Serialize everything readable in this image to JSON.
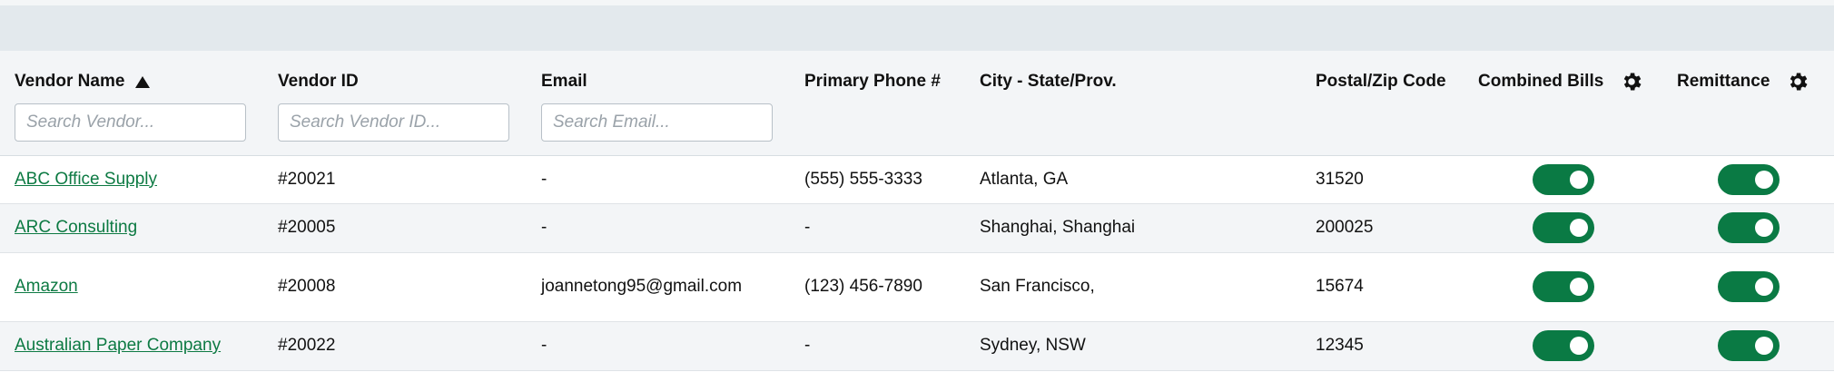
{
  "colors": {
    "accent": "#0a7a44",
    "link": "#0d7a43",
    "header_bg": "#f3f5f7",
    "topbar_bg": "#e3e9ed"
  },
  "table": {
    "headers": {
      "vendor_name": "Vendor Name",
      "vendor_id": "Vendor ID",
      "email": "Email",
      "phone": "Primary Phone #",
      "city": "City - State/Prov.",
      "postal": "Postal/Zip Code",
      "combined_bills": "Combined Bills",
      "remittance": "Remittance"
    },
    "sort": {
      "column": "vendor_name",
      "direction": "ascending",
      "icon": "sort-ascending-icon"
    },
    "search": {
      "vendor_placeholder": "Search Vendor...",
      "vendor_id_placeholder": "Search Vendor ID...",
      "email_placeholder": "Search Email..."
    },
    "rows": [
      {
        "name": "ABC Office Supply",
        "id": "#20021",
        "email": "-",
        "phone": "(555) 555-3333",
        "city": "Atlanta, GA",
        "postal": "31520",
        "combined_bills": true,
        "remittance": true
      },
      {
        "name": "ARC Consulting",
        "id": "#20005",
        "email": "-",
        "phone": "-",
        "city": "Shanghai, Shanghai",
        "postal": "200025",
        "combined_bills": true,
        "remittance": true
      },
      {
        "name": "Amazon",
        "id": "#20008",
        "email": "joannetong95@gmail.com",
        "phone": "(123) 456-7890",
        "city": "San Francisco,",
        "postal": "15674",
        "combined_bills": true,
        "remittance": true
      },
      {
        "name": "Australian Paper Company",
        "id": "#20022",
        "email": "-",
        "phone": "-",
        "city": "Sydney, NSW",
        "postal": "12345",
        "combined_bills": true,
        "remittance": true
      }
    ]
  }
}
